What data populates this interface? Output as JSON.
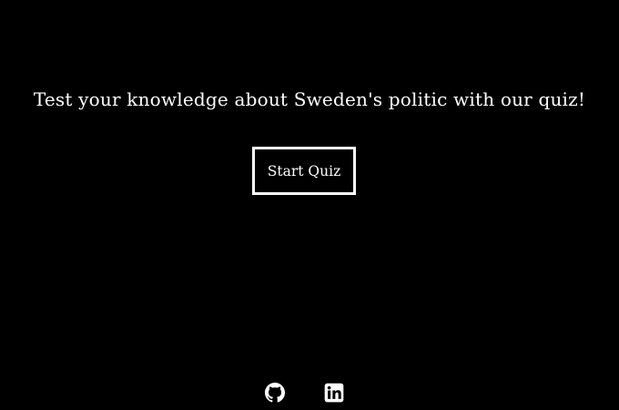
{
  "intro": {
    "heading": "Test your knowledge about Sweden's politic with our quiz!",
    "start_button_label": "Start Quiz"
  },
  "footer": {
    "links": [
      {
        "icon": "github-icon",
        "label": "GitHub"
      },
      {
        "icon": "linkedin-icon",
        "label": "LinkedIn"
      }
    ]
  },
  "colors": {
    "background": "#000000",
    "text": "#ffffff"
  }
}
